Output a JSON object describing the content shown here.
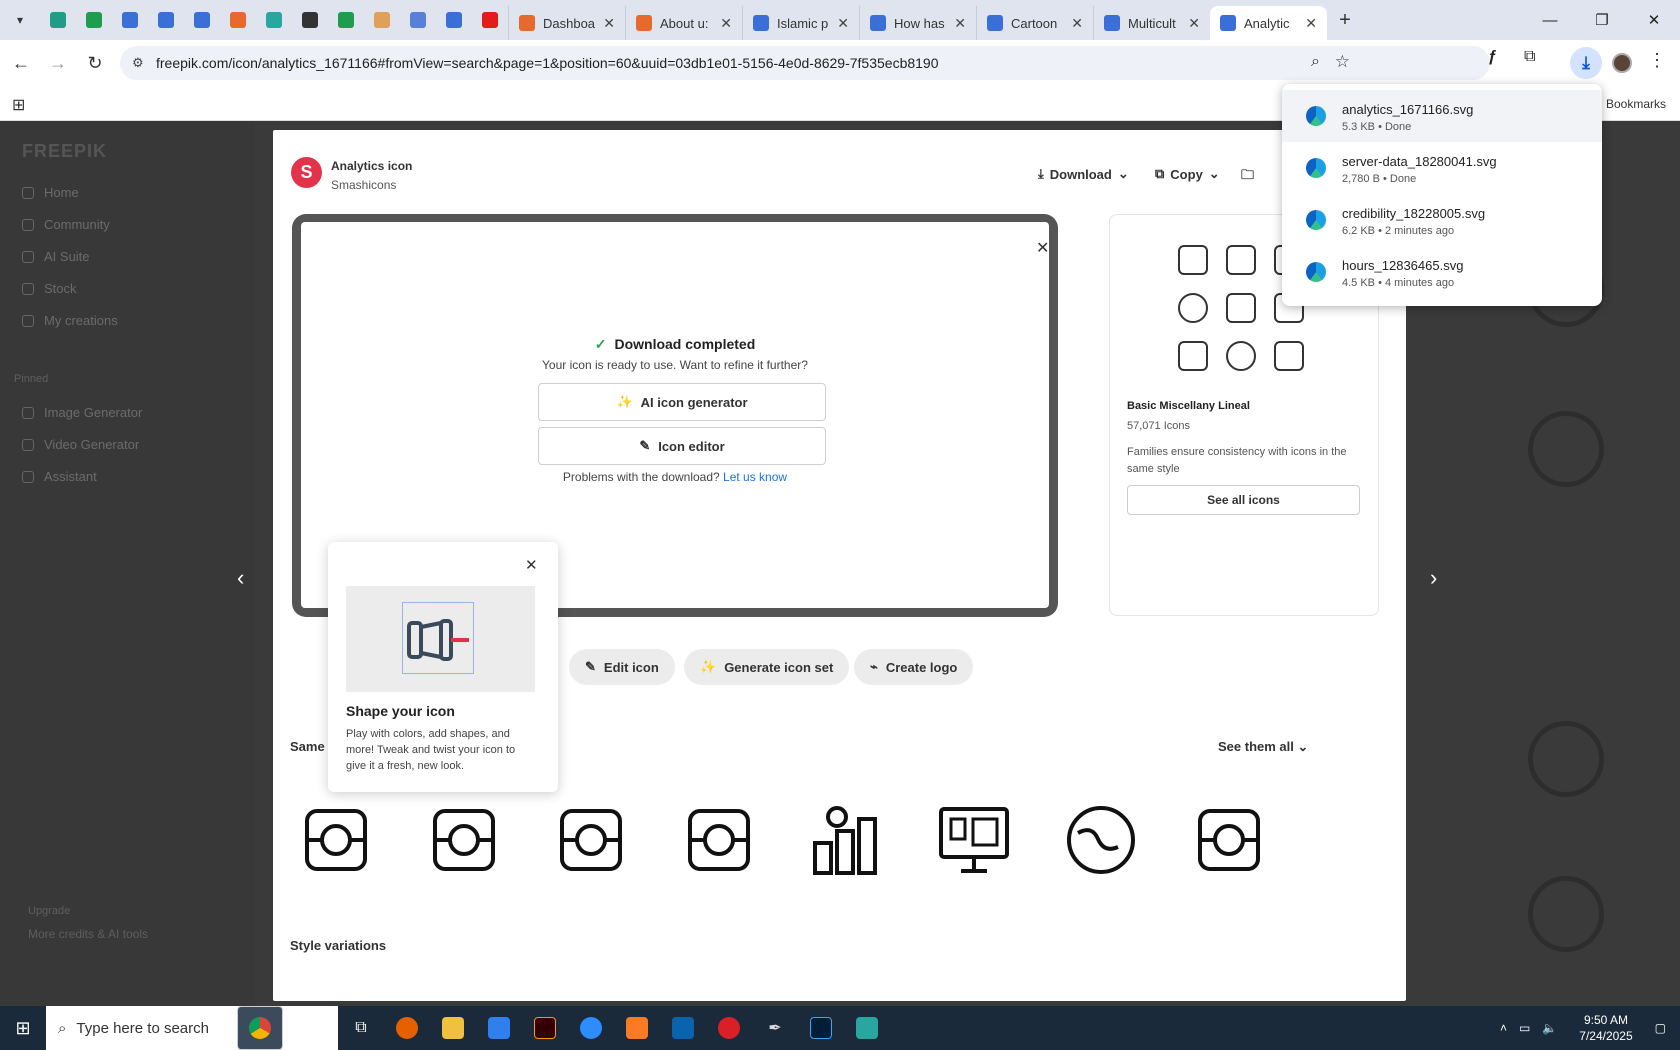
{
  "browser": {
    "tabs": [
      {
        "title": "Dashboa",
        "color": "#e8692c"
      },
      {
        "title": "About u:",
        "color": "#e8692c"
      },
      {
        "title": "Islamic p",
        "color": "#3a6fd8"
      },
      {
        "title": "How has",
        "color": "#3a6fd8"
      },
      {
        "title": "Cartoon",
        "color": "#3a6fd8"
      },
      {
        "title": "Multicult",
        "color": "#3a6fd8"
      },
      {
        "title": "Analytic",
        "color": "#3a6fd8"
      }
    ],
    "pinned_icons": [
      "vpn-icon",
      "sheets-icon",
      "docs-icon",
      "docs-icon",
      "docs-icon",
      "xampp-icon",
      "app-icon",
      "chatgpt-icon",
      "sheets-icon",
      "hand-icon",
      "grid-icon",
      "forms-icon",
      "youtube-icon"
    ],
    "url": "freepik.com/icon/analytics_1671166#fromView=search&page=1&position=60&uuid=03db1e01-5156-4e0d-8629-7f535ecb8190",
    "bookmarks_label": "Bookmarks"
  },
  "sidebar": {
    "logo": "FREEPIK",
    "items": [
      {
        "label": "Home"
      },
      {
        "label": "Community"
      },
      {
        "label": "AI Suite"
      },
      {
        "label": "Stock"
      },
      {
        "label": "My creations"
      }
    ],
    "pinned_label": "Pinned",
    "pinned_items": [
      {
        "label": "Image Generator"
      },
      {
        "label": "Video Generator"
      },
      {
        "label": "Assistant"
      }
    ],
    "upgrade_title": "Upgrade",
    "upgrade_text": "More credits & AI tools"
  },
  "modal": {
    "icon_title": "Analytics icon",
    "author": "Smashicons",
    "author_initial": "S",
    "download_label": "Download",
    "copy_label": "Copy",
    "download_completed": "Download completed",
    "ready_text": "Your icon is ready to use. Want to refine it further?",
    "ai_icon_generator": "AI icon generator",
    "icon_editor": "Icon editor",
    "problem_text": "Problems with the download?",
    "let_us_know": "Let us know",
    "family": {
      "name": "Basic Miscellany Lineal",
      "count": "57,071 Icons",
      "description": "Families ensure consistency with icons in the same style",
      "button": "See all icons"
    },
    "edit_icon": "Edit icon",
    "generate_icon_set": "Generate icon set",
    "create_logo": "Create logo",
    "same_title": "Same",
    "see_them_all": "See them all",
    "style_variations": "Style variations",
    "tooltip": {
      "title": "Shape your icon",
      "text": "Play with colors, add shapes, and more! Tweak and twist your icon to give it a fresh, new look."
    }
  },
  "downloads": [
    {
      "file": "analytics_1671166.svg",
      "status": "5.3 KB • Done"
    },
    {
      "file": "server-data_18280041.svg",
      "status": "2,780 B • Done"
    },
    {
      "file": "credibility_18228005.svg",
      "status": "6.2 KB • 2 minutes ago"
    },
    {
      "file": "hours_12836465.svg",
      "status": "4.5 KB • 4 minutes ago"
    }
  ],
  "taskbar": {
    "search_placeholder": "Type here to search",
    "time": "9:50 AM",
    "date": "7/24/2025"
  }
}
